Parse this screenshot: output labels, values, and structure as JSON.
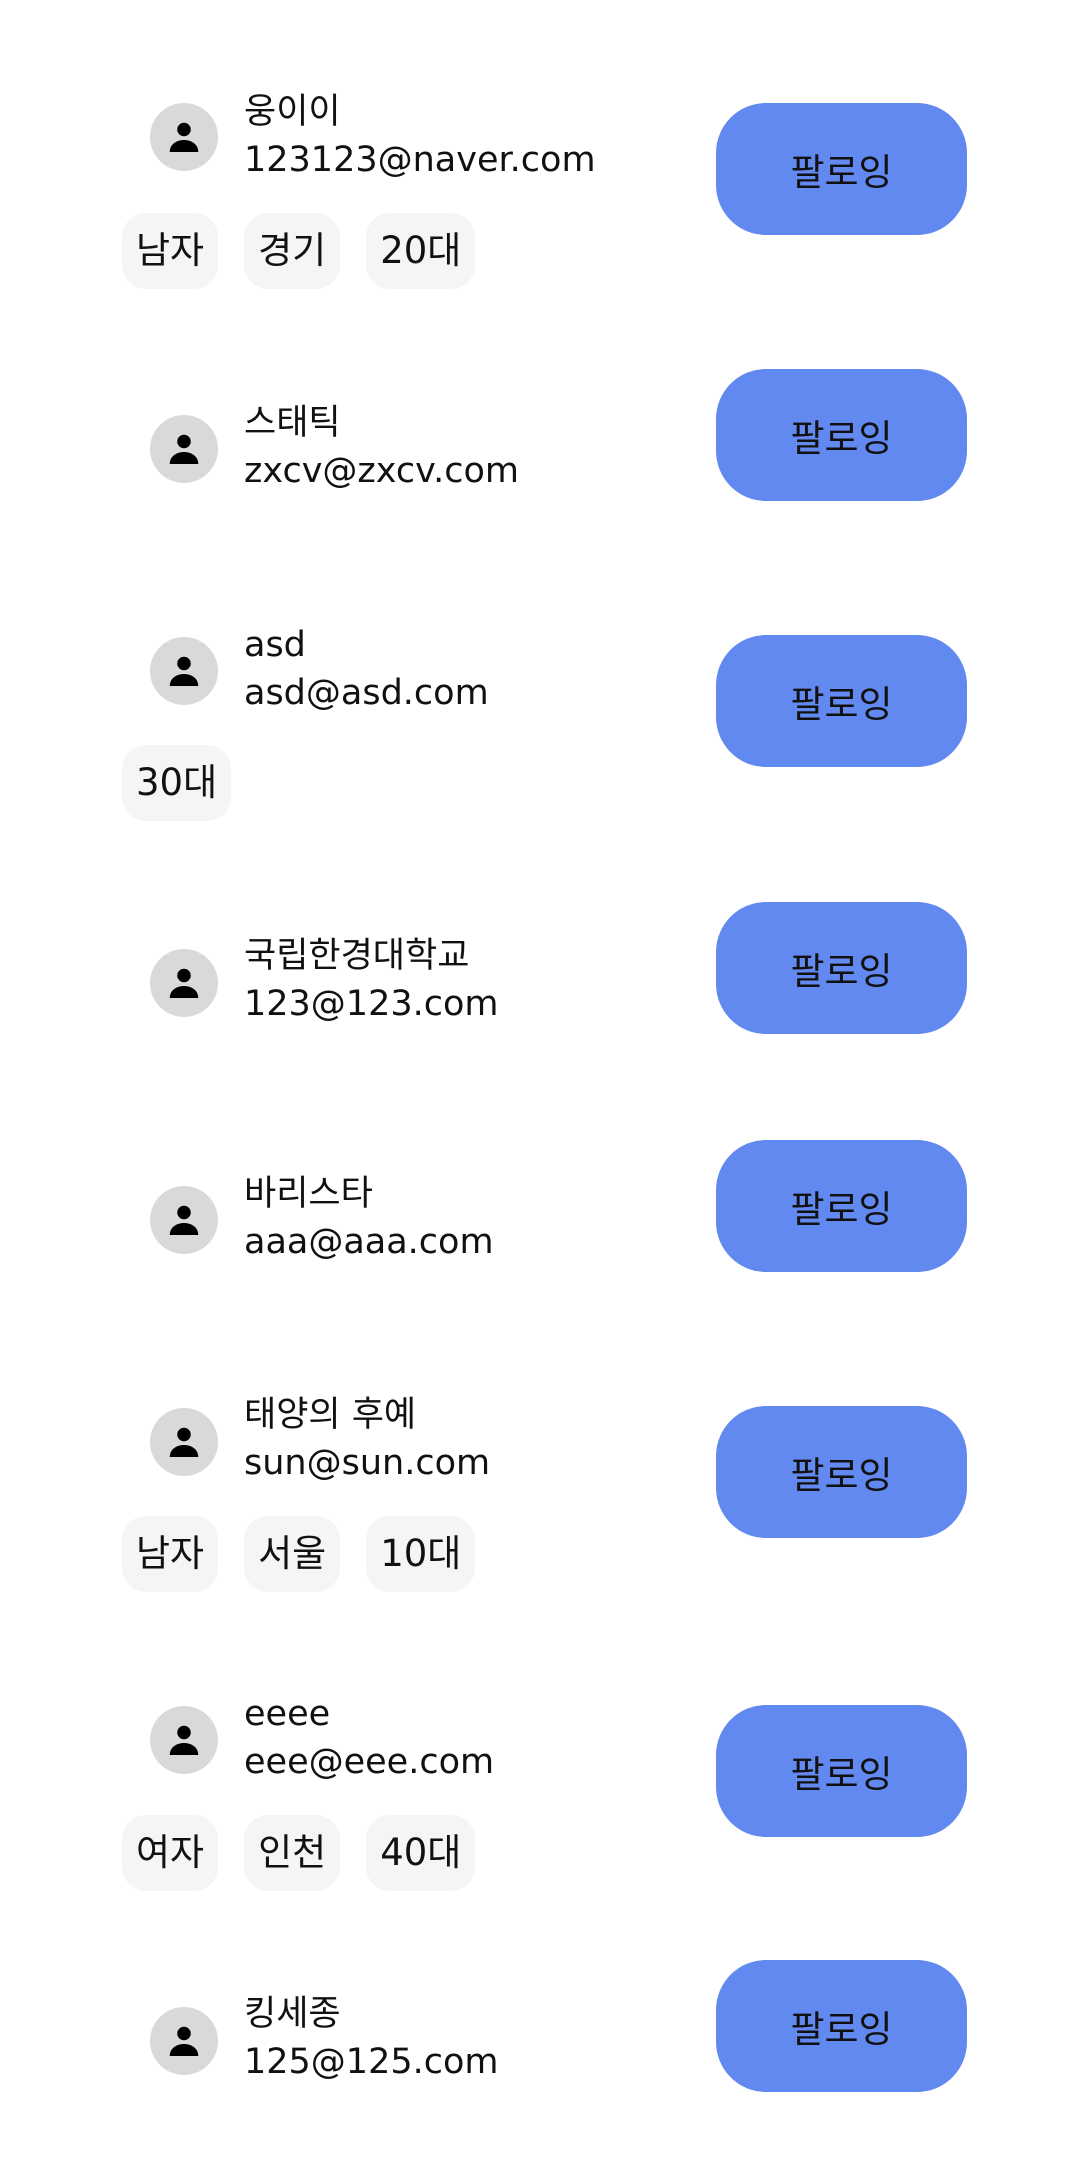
{
  "users": [
    {
      "name": "웅이이",
      "email": "123123@naver.com",
      "follow_label": "팔로잉",
      "tags": [
        "남자",
        "경기",
        "20대"
      ]
    },
    {
      "name": "스태틱",
      "email": "zxcv@zxcv.com",
      "follow_label": "팔로잉",
      "tags": []
    },
    {
      "name": "asd",
      "email": "asd@asd.com",
      "follow_label": "팔로잉",
      "tags": [
        "30대"
      ]
    },
    {
      "name": "국립한경대학교",
      "email": "123@123.com",
      "follow_label": "팔로잉",
      "tags": []
    },
    {
      "name": "바리스타",
      "email": "aaa@aaa.com",
      "follow_label": "팔로잉",
      "tags": []
    },
    {
      "name": "태양의 후예",
      "email": "sun@sun.com",
      "follow_label": "팔로잉",
      "tags": [
        "남자",
        "서울",
        "10대"
      ]
    },
    {
      "name": "eeee",
      "email": "eee@eee.com",
      "follow_label": "팔로잉",
      "tags": [
        "여자",
        "인천",
        "40대"
      ]
    },
    {
      "name": "킹세종",
      "email": "125@125.com",
      "follow_label": "팔로잉",
      "tags": []
    }
  ],
  "icons": {
    "avatar": "person-icon"
  },
  "colors": {
    "follow_button": "#6289f0",
    "avatar_bg": "#d9d9d9",
    "tag_bg": "#f5f5f5"
  }
}
